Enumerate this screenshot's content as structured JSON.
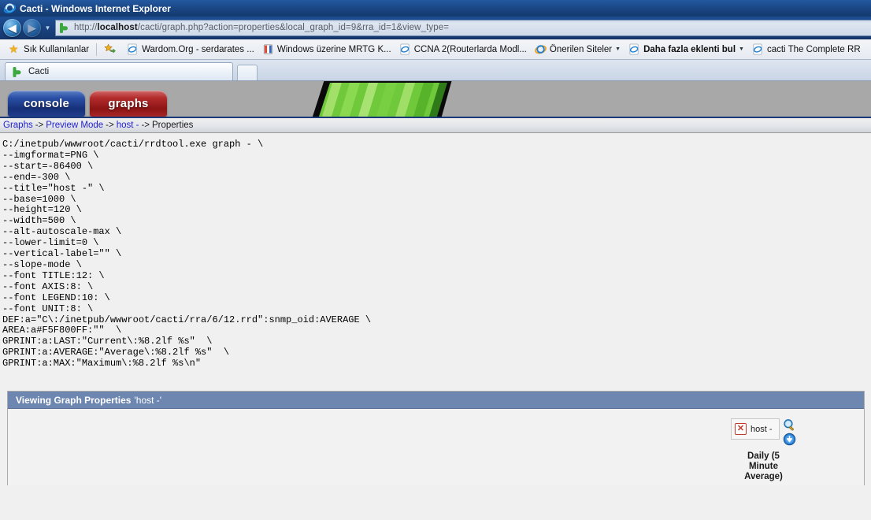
{
  "window": {
    "title": "Cacti - Windows Internet Explorer",
    "app_icon": "ie-logo-icon"
  },
  "navigation": {
    "back_label": "◀",
    "forward_label": "▶",
    "history_caret": "▼",
    "address": {
      "icon": "cacti-favicon-icon",
      "scheme": "http://",
      "host": "localhost",
      "path": "/cacti/graph.php?action=properties&local_graph_id=9&rra_id=1&view_type=",
      "full": "http://localhost/cacti/graph.php?action=properties&local_graph_id=9&rra_id=1&view_type="
    }
  },
  "favorites_bar": {
    "favorites_label": "Sık Kullanılanlar",
    "items": [
      {
        "label": "",
        "icon": "add-favorite-icon",
        "has_caret": false,
        "bold": false
      },
      {
        "label": "Wardom.Org - serdarates ...",
        "icon": "ie-page-icon",
        "has_caret": false,
        "bold": false
      },
      {
        "label": "Windows üzerine MRTG K...",
        "icon": "window-page-icon",
        "has_caret": false,
        "bold": false
      },
      {
        "label": "CCNA 2(Routerlarda Modl...",
        "icon": "ie-page-icon",
        "has_caret": false,
        "bold": false
      },
      {
        "label": "Önerilen Siteler",
        "icon": "ie-globe-icon",
        "has_caret": true,
        "bold": false
      },
      {
        "label": "Daha fazla eklenti bul",
        "icon": "ie-page-icon",
        "has_caret": true,
        "bold": true
      },
      {
        "label": "cacti The Complete RR",
        "icon": "ie-page-icon",
        "has_caret": false,
        "bold": false
      }
    ]
  },
  "tabs": {
    "items": [
      {
        "label": "Cacti",
        "icon": "cacti-favicon-icon",
        "active": true
      }
    ],
    "new_tab_label": ""
  },
  "cacti_banner": {
    "console_label": "console",
    "graphs_label": "graphs",
    "logo_alt": "cacti-logo-icon",
    "background_color": "#a8a8a8",
    "green_light": "#7dd13f",
    "green_mid": "#52b32a",
    "green_dark": "#2f7a18"
  },
  "breadcrumb": {
    "items": [
      {
        "label": "Graphs",
        "link": true
      },
      {
        "label": "Preview Mode",
        "link": true
      },
      {
        "label": "host -",
        "link": true
      },
      {
        "label": "Properties",
        "link": false
      }
    ],
    "separator": "->"
  },
  "command": {
    "lines": [
      "C:/inetpub/wwwroot/cacti/rrdtool.exe graph - \\",
      "--imgformat=PNG \\",
      "--start=-86400 \\",
      "--end=-300 \\",
      "--title=\"host -\" \\",
      "--base=1000 \\",
      "--height=120 \\",
      "--width=500 \\",
      "--alt-autoscale-max \\",
      "--lower-limit=0 \\",
      "--vertical-label=\"\" \\",
      "--slope-mode \\",
      "--font TITLE:12: \\",
      "--font AXIS:8: \\",
      "--font LEGEND:10: \\",
      "--font UNIT:8: \\",
      "DEF:a=\"C\\:/inetpub/wwwroot/cacti/rra/6/12.rrd\":snmp_oid:AVERAGE \\",
      "AREA:a#F5F800FF:\"\"  \\",
      "GPRINT:a:LAST:\"Current\\:%8.2lf %s\"  \\",
      "GPRINT:a:AVERAGE:\"Average\\:%8.2lf %s\"  \\",
      "GPRINT:a:MAX:\"Maximum\\:%8.2lf %s\\n\""
    ],
    "text": "C:/inetpub/wwwroot/cacti/rrdtool.exe graph - \\\n--imgformat=PNG \\\n--start=-86400 \\\n--end=-300 \\\n--title=\"host -\" \\\n--base=1000 \\\n--height=120 \\\n--width=500 \\\n--alt-autoscale-max \\\n--lower-limit=0 \\\n--vertical-label=\"\" \\\n--slope-mode \\\n--font TITLE:12: \\\n--font AXIS:8: \\\n--font LEGEND:10: \\\n--font UNIT:8: \\\nDEF:a=\"C\\:/inetpub/wwwroot/cacti/rra/6/12.rrd\":snmp_oid:AVERAGE \\\nAREA:a#F5F800FF:\"\"  \\\nGPRINT:a:LAST:\"Current\\:%8.2lf %s\"  \\\nGPRINT:a:AVERAGE:\"Average\\:%8.2lf %s\"  \\\nGPRINT:a:MAX:\"Maximum\\:%8.2lf %s\\n\""
  },
  "panel": {
    "header_title": "Viewing Graph Properties",
    "header_subject": "'host -'",
    "header_color": "#6d87b1",
    "graph": {
      "broken_image_alt": "host -",
      "broken_icon": "broken-image-x-icon",
      "zoom_icon": "magnifier-zoom-icon",
      "download_icon": "download-arrow-icon",
      "caption": "Daily (5 Minute Average)"
    }
  }
}
